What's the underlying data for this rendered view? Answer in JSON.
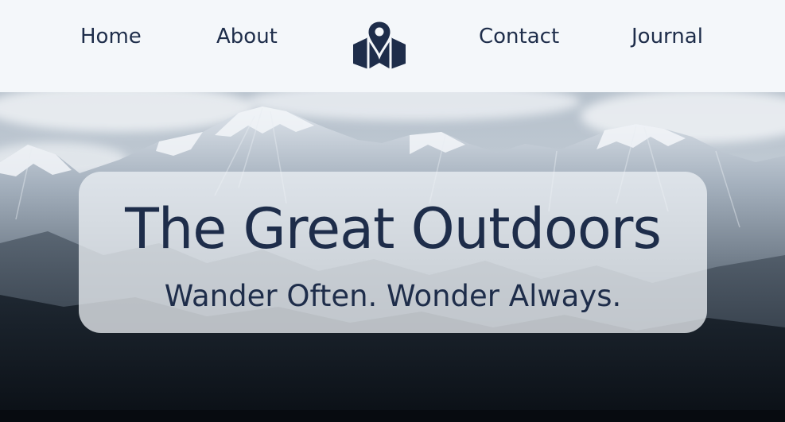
{
  "nav": {
    "links": [
      "Home",
      "About",
      "Contact",
      "Journal"
    ],
    "logo_icon": "map-pin-icon"
  },
  "hero": {
    "title": "The Great Outdoors",
    "subtitle": "Wander Often. Wonder Always.",
    "background": "snowy-mountain-range-photo"
  },
  "colors": {
    "navbar_bg": "#f4f7fa",
    "text_navy": "#1e2d4a"
  }
}
